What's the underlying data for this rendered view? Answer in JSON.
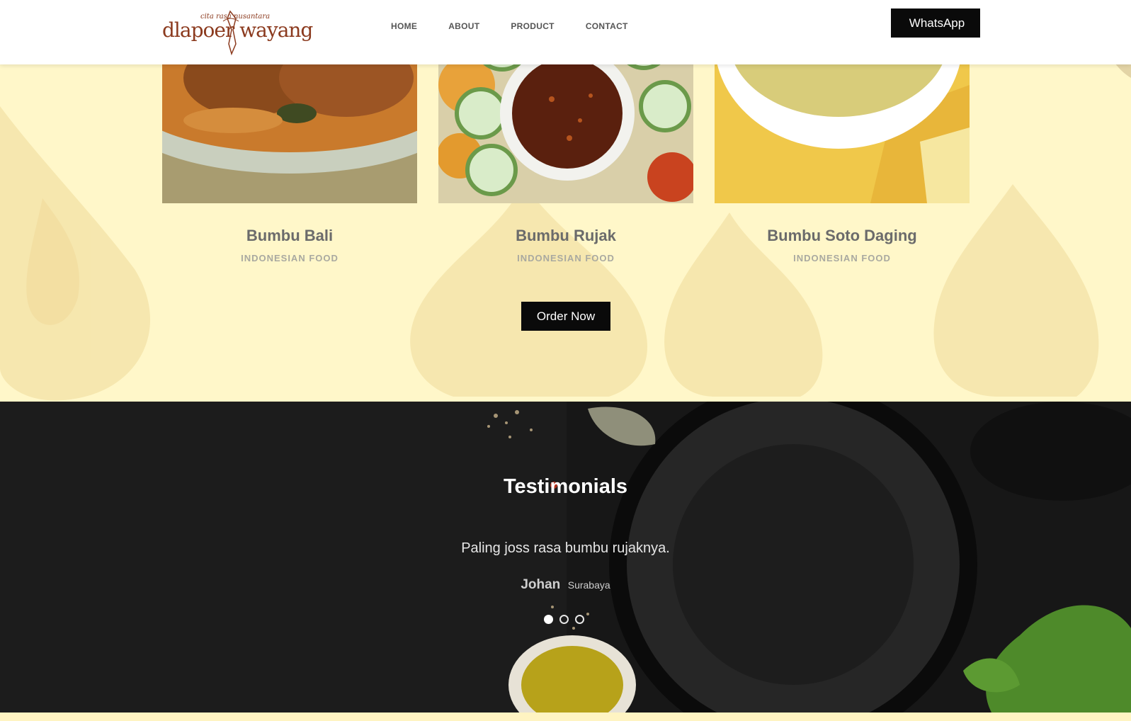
{
  "header": {
    "logo_tagline": "cita rasa nusantara",
    "logo_name": "dlapoer wayang",
    "nav": [
      "HOME",
      "ABOUT",
      "PRODUCT",
      "CONTACT"
    ],
    "whatsapp_label": "WhatsApp"
  },
  "products": [
    {
      "title": "Bumbu Bali",
      "category": "INDONESIAN FOOD"
    },
    {
      "title": "Bumbu Rujak",
      "category": "INDONESIAN FOOD"
    },
    {
      "title": "Bumbu Soto Daging",
      "category": "INDONESIAN FOOD"
    }
  ],
  "order_label": "Order Now",
  "testimonials": {
    "heading": "Testimonials",
    "quote": "Paling joss rasa bumbu rujaknya.",
    "author": "Johan",
    "location": "Surabaya",
    "active_slide": 1,
    "slide_count": 3
  },
  "colors": {
    "brand": "#8b3a1e",
    "section_bg": "#fff7c9",
    "button_bg": "#0a0a0a"
  }
}
